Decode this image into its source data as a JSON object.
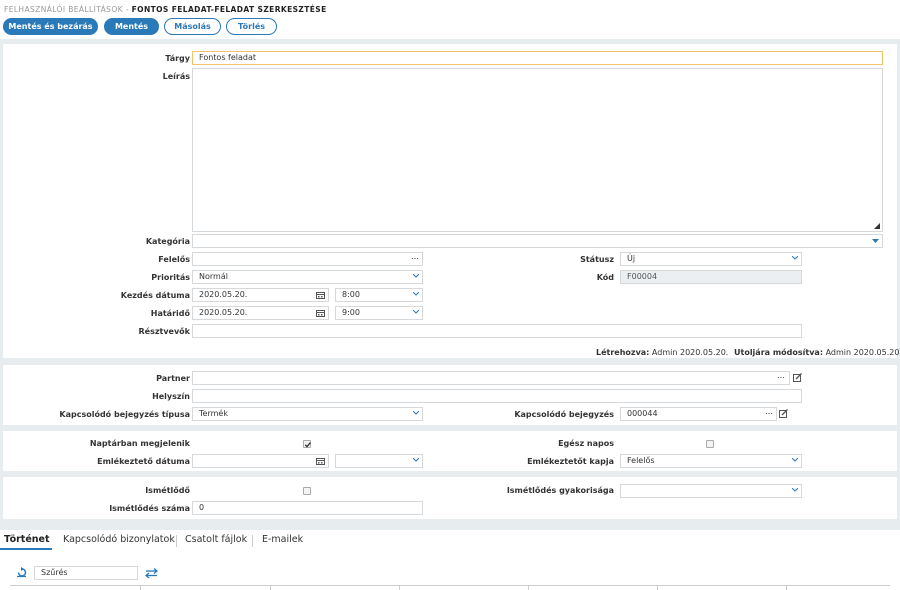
{
  "breadcrumb": {
    "parent": "FELHASZNÁLÓI BEÁLLÍTÁSOK",
    "separator": " - ",
    "current": "FONTOS FELADAT-FELADAT SZERKESZTÉSE"
  },
  "toolbar": {
    "save_close": "Mentés és bezárás",
    "save": "Mentés",
    "copy": "Másolás",
    "delete": "Törlés"
  },
  "form": {
    "subject": {
      "label": "Tárgy",
      "value": "Fontos feladat"
    },
    "description": {
      "label": "Leírás",
      "value": ""
    },
    "category": {
      "label": "Kategória",
      "value": ""
    },
    "responsible": {
      "label": "Felelős",
      "value": ""
    },
    "status": {
      "label": "Státusz",
      "value": "Új"
    },
    "priority": {
      "label": "Prioritás",
      "value": "Normál"
    },
    "code": {
      "label": "Kód",
      "value": "F00004"
    },
    "start": {
      "label": "Kezdés dátuma",
      "date": "2020.05.20.",
      "time": "8:00"
    },
    "deadline": {
      "label": "Határidő",
      "date": "2020.05.20.",
      "time": "9:00"
    },
    "participants": {
      "label": "Résztvevők",
      "value": ""
    },
    "created": {
      "label": "Létrehozva:",
      "value": " Admin 2020.05.20."
    },
    "modified": {
      "label": "Utoljára módosítva:",
      "value": " Admin 2020.05.20."
    }
  },
  "relations": {
    "partner": {
      "label": "Partner",
      "value": ""
    },
    "location": {
      "label": "Helyszín",
      "value": ""
    },
    "related_type": {
      "label": "Kapcsolódó bejegyzés típusa",
      "value": "Termék"
    },
    "related_entry": {
      "label": "Kapcsolódó bejegyzés",
      "value": "000044"
    }
  },
  "calendar": {
    "show_in_calendar": {
      "label": "Naptárban megjelenik",
      "checked": true
    },
    "all_day": {
      "label": "Egész napos",
      "checked": false
    },
    "reminder_date": {
      "label": "Emlékeztető dátuma",
      "date": "",
      "time": ""
    },
    "reminder_recipient": {
      "label": "Emlékeztetőt kapja",
      "value": "Felelős"
    }
  },
  "recurrence": {
    "recurring": {
      "label": "Ismétlődő",
      "checked": false
    },
    "frequency": {
      "label": "Ismétlődés gyakorisága",
      "value": ""
    },
    "count": {
      "label": "Ismétlődés száma",
      "value": "0"
    }
  },
  "tabs": [
    "Történet",
    "Kapcsolódó bizonylatok",
    "Csatolt fájlok",
    "E-mailek"
  ],
  "history": {
    "filter_placeholder": "Szűrés"
  },
  "colors": {
    "primary": "#2a79b8",
    "background": "#e7ecef",
    "focus": "#f0c36d"
  }
}
